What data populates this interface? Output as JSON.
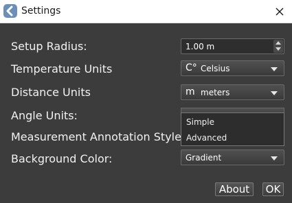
{
  "window": {
    "title": "Settings",
    "app_icon": "back-arrow-icon",
    "close_icon": "close-icon"
  },
  "settings": {
    "setup_radius": {
      "label": "Setup Radius:",
      "value": "1.00 m"
    },
    "temperature_units": {
      "label": "Temperature Units",
      "glyph": "C°",
      "value": "Celsius"
    },
    "distance_units": {
      "label": "Distance Units",
      "glyph": "m",
      "value": "meters"
    },
    "angle_units": {
      "label": "Angle Units:"
    },
    "annotation_style": {
      "label": "Measurement Annotation Style:",
      "options": [
        "Simple",
        "Advanced"
      ]
    },
    "background_color": {
      "label": "Background Color:",
      "value": "Gradient"
    }
  },
  "buttons": {
    "about": "About",
    "ok": "OK"
  },
  "colors": {
    "background": "#3c3c3c",
    "titlebar": "#ffffff",
    "text": "#f2f2f2",
    "app_icon": "#6c8fb8"
  }
}
